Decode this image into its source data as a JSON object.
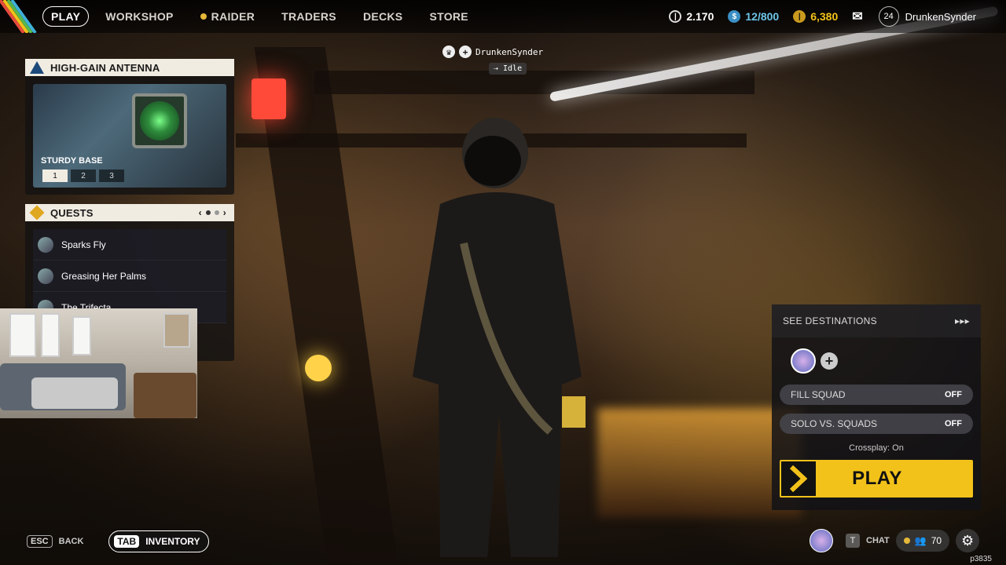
{
  "nav": {
    "items": [
      {
        "label": "PLAY",
        "active": true
      },
      {
        "label": "WORKSHOP"
      },
      {
        "label": "RAIDER",
        "has_coin": true
      },
      {
        "label": "TRADERS"
      },
      {
        "label": "DECKS"
      },
      {
        "label": "STORE"
      }
    ]
  },
  "currencies": {
    "credits": "2.170",
    "cred_capacity": "12/800",
    "coins": "6,380",
    "level": "24",
    "username": "DrunkenSynder"
  },
  "player_tag": {
    "name": "DrunkenSynder",
    "status": "Idle"
  },
  "antenna_panel": {
    "title": "HIGH-GAIN ANTENNA",
    "subtitle": "STURDY BASE",
    "tiers": [
      "1",
      "2",
      "3"
    ],
    "selected_tier": "1"
  },
  "quests_panel": {
    "title": "QUESTS",
    "items": [
      {
        "label": "Sparks Fly"
      },
      {
        "label": "Greasing Her Palms"
      },
      {
        "label": "The Trifecta"
      }
    ]
  },
  "destinations": {
    "header": "SEE DESTINATIONS",
    "fill_squad_label": "FILL SQUAD",
    "fill_squad_value": "OFF",
    "solo_label": "SOLO VS. SQUADS",
    "solo_value": "OFF",
    "crossplay": "Crossplay: On",
    "play_label": "PLAY"
  },
  "bottom": {
    "esc_key": "ESC",
    "back_label": "BACK",
    "tab_key": "TAB",
    "inventory_label": "INVENTORY",
    "chat_key": "T",
    "chat_label": "CHAT",
    "friends_count": "70",
    "build": "p3835"
  },
  "icons": {
    "credits": "credits-icon",
    "cred_capacity": "cred-icon",
    "coins": "coins-icon",
    "mail": "mail-icon",
    "settings": "gear-icon"
  },
  "colors": {
    "accent_yellow": "#f2c21a",
    "panel_cream": "#f1ece2"
  }
}
